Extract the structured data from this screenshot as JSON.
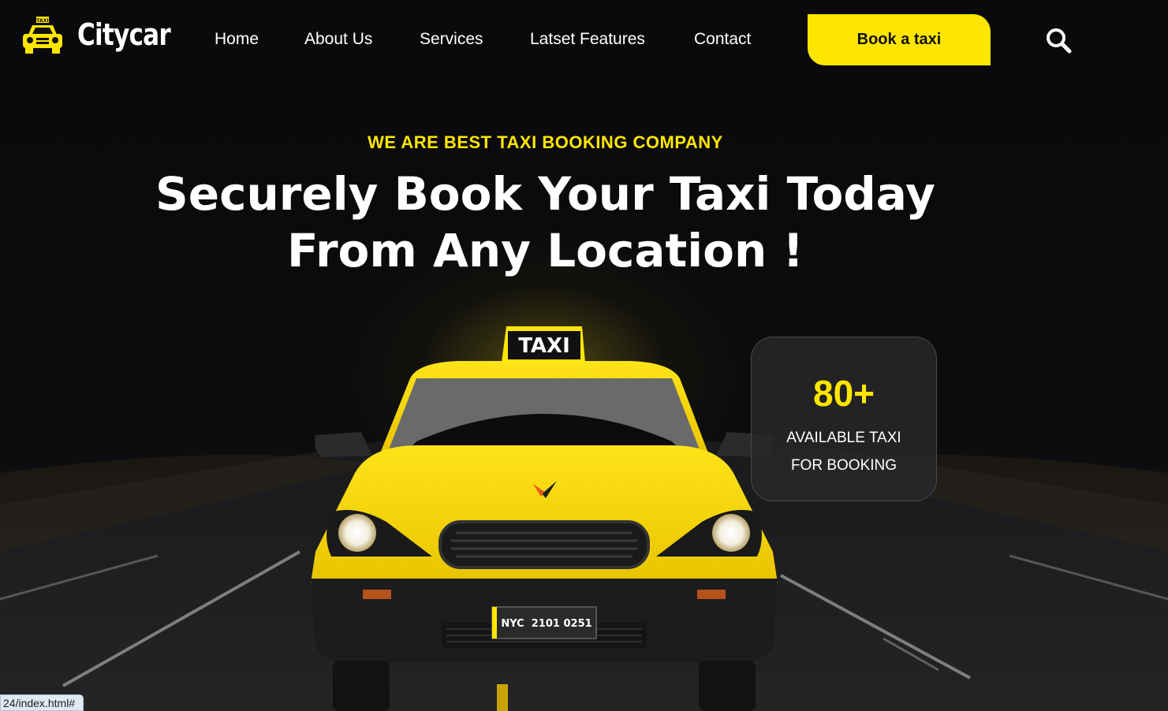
{
  "brand": {
    "name": "Citycar",
    "icon": "taxi-car-icon",
    "icon_badge": "TAXI"
  },
  "nav": [
    {
      "label": "Home"
    },
    {
      "label": "About Us"
    },
    {
      "label": "Services"
    },
    {
      "label": "Latset Features"
    },
    {
      "label": "Contact"
    }
  ],
  "cta": {
    "label": "Book a taxi"
  },
  "search": {
    "icon": "search-icon"
  },
  "hero": {
    "tagline": "WE ARE BEST TAXI BOOKING COMPANY",
    "headline_line1": "Securely Book Your Taxi Today",
    "headline_line2": "From Any Location !",
    "car_roof_sign": "TAXI",
    "license_plate": "NYC  2101 0251"
  },
  "stat": {
    "number": "80+",
    "label": "AVAILABLE TAXI FOR BOOKING"
  },
  "status_bar": {
    "url": "24/index.html#"
  },
  "colors": {
    "accent": "#ffe600",
    "background": "#0b0b0d",
    "card": "#28282a"
  }
}
